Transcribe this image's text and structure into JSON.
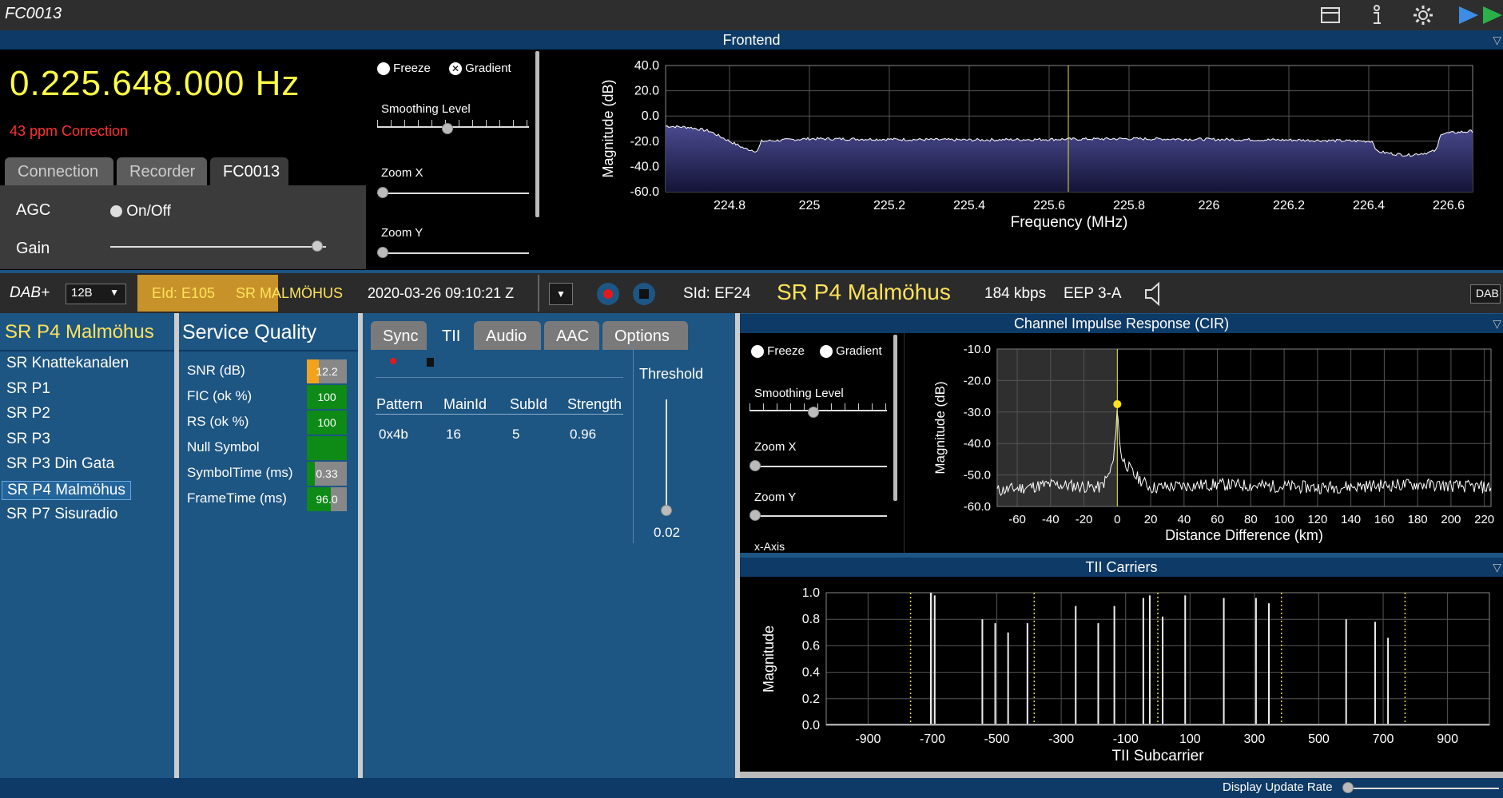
{
  "app": {
    "title": "FC0013"
  },
  "toolbar_icons": [
    "window-icon",
    "info-icon",
    "gear-icon",
    "play-icon"
  ],
  "frontend": {
    "panel_title": "Frontend",
    "frequency": "0.225.648.000",
    "unit": "Hz",
    "ppm": "43 ppm Correction",
    "tabs": [
      "Connection",
      "Recorder",
      "FC0013"
    ],
    "agc_label": "AGC",
    "agc_toggle": "On/Off",
    "gain_label": "Gain",
    "gain_level": 0.96,
    "controls": {
      "freeze": "Freeze",
      "gradient": "Gradient",
      "smoothing": "Smoothing Level",
      "zoom_x": "Zoom X",
      "zoom_y": "Zoom Y"
    }
  },
  "status": {
    "mode": "DAB+",
    "channel": "12B",
    "eid": "EId: E105",
    "ensemble": "SR MALMÖHUS",
    "datetime": "2020-03-26  09:10:21 Z",
    "sid": "SId: EF24",
    "service": "SR P4 Malmöhus",
    "bitrate": "184 kbps",
    "eep": "EEP 3-A",
    "dab_btn": "DAB"
  },
  "services": {
    "title": "SR P4 Malmöhus",
    "items": [
      "SR Knattekanalen",
      "SR P1",
      "SR P2",
      "SR P3",
      "SR P3 Din Gata",
      "SR P4 Malmöhus",
      "SR P7 Sisuradio"
    ],
    "selected": 5
  },
  "quality": {
    "title": "Service Quality",
    "rows": [
      {
        "label": "SNR (dB)",
        "value": "12.2",
        "fill": 0.3,
        "color": "#f2a31b"
      },
      {
        "label": "FIC (ok %)",
        "value": "100",
        "fill": 1.0,
        "color": "#0e8a17"
      },
      {
        "label": "RS (ok %)",
        "value": "100",
        "fill": 1.0,
        "color": "#0e8a17"
      },
      {
        "label": "Null Symbol",
        "value": "",
        "fill": 1.0,
        "color": "#0e8a17"
      },
      {
        "label": "SymbolTime (ms)",
        "value": "0.33",
        "fill": 0.2,
        "color": "#0e8a17"
      },
      {
        "label": "FrameTime (ms)",
        "value": "96.0",
        "fill": 0.6,
        "color": "#0e8a17"
      }
    ]
  },
  "tii_panel": {
    "tabs": [
      "Sync",
      "TII",
      "Audio",
      "AAC",
      "Options"
    ],
    "active_tab": 1,
    "headers": [
      "Pattern",
      "MainId",
      "SubId",
      "Strength"
    ],
    "rows": [
      [
        "0x4b",
        "16",
        "5",
        "0.96"
      ]
    ],
    "threshold_label": "Threshold",
    "threshold_value": "0.02"
  },
  "cir": {
    "panel_title": "Channel Impulse Response (CIR)",
    "controls": {
      "freeze": "Freeze",
      "gradient": "Gradient",
      "smoothing": "Smoothing Level",
      "zoom_x": "Zoom X",
      "zoom_y": "Zoom Y",
      "xaxis": "x-Axis"
    }
  },
  "tii_carriers": {
    "panel_title": "TII Carriers"
  },
  "footer": {
    "update_rate": "Display Update Rate"
  },
  "chart_data": [
    {
      "type": "area",
      "xlabel": "Frequency (MHz)",
      "ylabel": "Magnitude (dB)",
      "xlim": [
        224.64,
        226.66
      ],
      "ylim": [
        -60,
        40
      ],
      "xticks": [
        "224.8",
        "225",
        "225.2",
        "225.4",
        "225.6",
        "225.8",
        "226",
        "226.2",
        "226.4",
        "226.6"
      ],
      "yticks": [
        "40.0",
        "20.0",
        "0.0",
        "-20.0",
        "-40.0",
        "-60.0"
      ],
      "marker_x": 225.648,
      "x": [
        224.64,
        224.7,
        224.75,
        224.8,
        224.84,
        224.87,
        224.88,
        225.0,
        225.4,
        225.8,
        226.2,
        226.41,
        226.42,
        226.46,
        226.5,
        226.55,
        226.57,
        226.58,
        226.66
      ],
      "values": [
        -8,
        -9,
        -12,
        -20,
        -26,
        -28,
        -20,
        -18,
        -19,
        -18,
        -19,
        -20,
        -28,
        -30,
        -31,
        -29,
        -27,
        -14,
        -12
      ]
    },
    {
      "type": "line",
      "xlabel": "Distance Difference (km)",
      "ylabel": "Magnitude (dB)",
      "xlim": [
        -72,
        224
      ],
      "ylim": [
        -60,
        -10
      ],
      "xticks": [
        "-60",
        "-40",
        "-20",
        "0",
        "20",
        "40",
        "60",
        "80",
        "100",
        "120",
        "140",
        "160",
        "180",
        "200",
        "220"
      ],
      "yticks": [
        "-10.0",
        "-20.0",
        "-30.0",
        "-40.0",
        "-50.0",
        "-60.0"
      ],
      "peak": {
        "x": 0,
        "y": -27.5
      },
      "shaded_to_x": 0,
      "x": [
        -72,
        -40,
        -10,
        -5,
        -2,
        0,
        1,
        3,
        6,
        10,
        20,
        60,
        120,
        180,
        224
      ],
      "values": [
        -55,
        -53,
        -54,
        -50,
        -45,
        -27.5,
        -38,
        -45,
        -47,
        -50,
        -54,
        -53,
        -54,
        -53,
        -54
      ]
    },
    {
      "type": "bar",
      "xlabel": "TII Subcarrier",
      "ylabel": "Magnitude",
      "xlim": [
        -1030,
        1030
      ],
      "ylim": [
        0,
        1.0
      ],
      "xticks": [
        "-900",
        "-700",
        "-500",
        "-300",
        "-100",
        "100",
        "300",
        "500",
        "700",
        "900"
      ],
      "yticks": [
        "1.0",
        "0.8",
        "0.6",
        "0.4",
        "0.2",
        "0.0"
      ],
      "dotted_markers": [
        -768,
        -384,
        0,
        384,
        768
      ],
      "x": [
        -705,
        -693,
        -545,
        -505,
        -465,
        -405,
        -255,
        -185,
        -135,
        -45,
        -25,
        15,
        85,
        205,
        305,
        345,
        585,
        675,
        715
      ],
      "values": [
        1.0,
        0.98,
        0.8,
        0.77,
        0.7,
        0.77,
        0.9,
        0.77,
        0.9,
        0.96,
        0.98,
        0.82,
        0.98,
        0.96,
        0.96,
        0.92,
        0.8,
        0.78,
        0.66
      ]
    }
  ]
}
